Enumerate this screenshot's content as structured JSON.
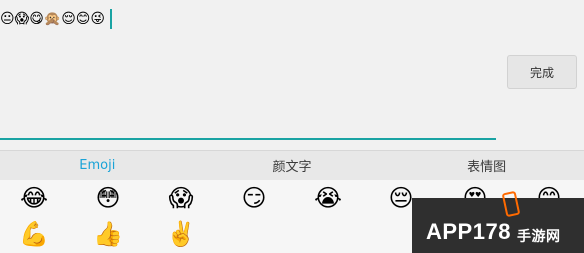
{
  "editor": {
    "emoji_text": "😐😱😋🙊😌😊😜",
    "done_label": "完成"
  },
  "tabs": [
    {
      "label": "Emoji",
      "active": true
    },
    {
      "label": "颜文字",
      "active": false
    },
    {
      "label": "表情图",
      "active": false
    }
  ],
  "emoji_grid": {
    "row1": [
      "😂",
      "😳",
      "😱",
      "😏",
      "😭",
      "😔",
      "😍",
      "😊"
    ],
    "row2": [
      "💪",
      "👍",
      "✌️"
    ]
  },
  "watermark": {
    "main": "APP178",
    "sub": "手游网"
  },
  "colors": {
    "accent": "#1aa3a3",
    "tab_active": "#1aa3d7",
    "watermark_bg": "#2f2f2f",
    "watermark_accent": "#ff6a00"
  }
}
